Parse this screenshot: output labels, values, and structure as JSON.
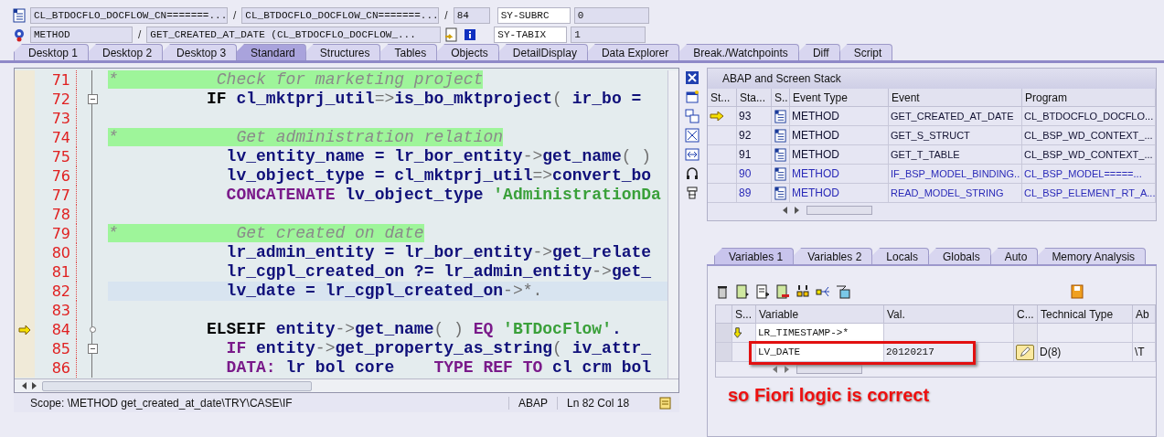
{
  "header": {
    "rows": [
      {
        "fields": [
          {
            "value": "CL_BTDOCFLO_DOCFLOW_CN=======..."
          },
          {
            "sep": "/",
            "value": "CL_BTDOCFLO_DOCFLOW_CN=======..."
          },
          {
            "sep": "/",
            "value": "84"
          }
        ],
        "sys_name": "SY-SUBRC",
        "sys_value": "0"
      },
      {
        "fields": [
          {
            "value": "METHOD"
          },
          {
            "sep": "/",
            "value": "GET_CREATED_AT_DATE (CL_BTDOCFLO_DOCFLOW_..."
          }
        ],
        "sys_name": "SY-TABIX",
        "sys_value": "1"
      }
    ]
  },
  "tabs": [
    {
      "label": "Desktop 1",
      "selected": false
    },
    {
      "label": "Desktop 2",
      "selected": false
    },
    {
      "label": "Desktop 3",
      "selected": false
    },
    {
      "label": "Standard",
      "selected": true
    },
    {
      "label": "Structures",
      "selected": false
    },
    {
      "label": "Tables",
      "selected": false
    },
    {
      "label": "Objects",
      "selected": false
    },
    {
      "label": "DetailDisplay",
      "selected": false
    },
    {
      "label": "Data Explorer",
      "selected": false
    },
    {
      "label": "Break./Watchpoints",
      "selected": false
    },
    {
      "label": "Diff",
      "selected": false
    },
    {
      "label": "Script",
      "selected": false
    }
  ],
  "editor": {
    "lines": [
      {
        "number": "71",
        "comment": true,
        "current": false,
        "cursor": false,
        "collapsible": false,
        "tokens": [
          {
            "text": "*          Check for marketing project",
            "kind": "comment"
          }
        ]
      },
      {
        "number": "72",
        "comment": false,
        "current": false,
        "cursor": false,
        "collapsible": true,
        "tokens": [
          {
            "text": "          IF",
            "kind": "keyword"
          },
          {
            "text": " cl_mktprj_util",
            "kind": "ident"
          },
          {
            "text": "=>",
            "kind": "op"
          },
          {
            "text": "is_bo_mktproject",
            "kind": "ident"
          },
          {
            "text": "( ",
            "kind": "op"
          },
          {
            "text": "ir_bo =",
            "kind": "ident"
          }
        ]
      },
      {
        "number": "73",
        "current": false,
        "cursor": false,
        "collapsible": false
      },
      {
        "number": "74",
        "comment": true,
        "current": false,
        "cursor": false,
        "collapsible": false,
        "tokens": [
          {
            "text": "*            Get administration relation",
            "kind": "comment"
          }
        ]
      },
      {
        "number": "75",
        "comment": false,
        "current": false,
        "cursor": false,
        "collapsible": false,
        "tokens": [
          {
            "text": "            lv_entity_name = lr_bor_entity",
            "kind": "ident"
          },
          {
            "text": "->",
            "kind": "op"
          },
          {
            "text": "get_name",
            "kind": "ident"
          },
          {
            "text": "( )",
            "kind": "op"
          }
        ]
      },
      {
        "number": "76",
        "comment": false,
        "current": false,
        "cursor": false,
        "collapsible": false,
        "tokens": [
          {
            "text": "            lv_object_type = cl_mktprj_util",
            "kind": "ident"
          },
          {
            "text": "=>",
            "kind": "op"
          },
          {
            "text": "convert_bo",
            "kind": "ident"
          }
        ]
      },
      {
        "number": "77",
        "comment": false,
        "current": false,
        "cursor": false,
        "collapsible": false,
        "tokens": [
          {
            "text": "            CONCATENATE",
            "kind": "keyword2"
          },
          {
            "text": " lv_object_type ",
            "kind": "ident"
          },
          {
            "text": "'AdministrationDa",
            "kind": "string"
          }
        ]
      },
      {
        "number": "78",
        "current": false,
        "cursor": false,
        "collapsible": false
      },
      {
        "number": "79",
        "comment": true,
        "current": false,
        "cursor": false,
        "collapsible": false,
        "tokens": [
          {
            "text": "*            Get created on date",
            "kind": "comment"
          }
        ]
      },
      {
        "number": "80",
        "comment": false,
        "current": false,
        "cursor": false,
        "collapsible": false,
        "tokens": [
          {
            "text": "            lr_admin_entity = lr_bor_entity",
            "kind": "ident"
          },
          {
            "text": "->",
            "kind": "op"
          },
          {
            "text": "get_relate",
            "kind": "ident"
          }
        ]
      },
      {
        "number": "81",
        "comment": false,
        "current": false,
        "cursor": false,
        "collapsible": false,
        "tokens": [
          {
            "text": "            lr_cgpl_created_on ?= lr_admin_entity",
            "kind": "ident"
          },
          {
            "text": "->",
            "kind": "op"
          },
          {
            "text": "get_",
            "kind": "ident"
          }
        ]
      },
      {
        "number": "82",
        "comment": false,
        "current": false,
        "cursor": true,
        "collapsible": false,
        "tokens": [
          {
            "text": "            lv_date = lr_cgpl_created_on",
            "kind": "ident"
          },
          {
            "text": "->*.",
            "kind": "op"
          }
        ]
      },
      {
        "number": "83",
        "current": false,
        "cursor": false,
        "collapsible": false
      },
      {
        "number": "84",
        "comment": false,
        "current": true,
        "cursor": false,
        "collapsible": false,
        "tokens": [
          {
            "text": "          ELSEIF",
            "kind": "keyword"
          },
          {
            "text": " entity",
            "kind": "ident"
          },
          {
            "text": "->",
            "kind": "op"
          },
          {
            "text": "get_name",
            "kind": "ident"
          },
          {
            "text": "( ) ",
            "kind": "op"
          },
          {
            "text": "EQ",
            "kind": "keyword2"
          },
          {
            "text": " 'BTDocFlow'",
            "kind": "string"
          },
          {
            "text": ".",
            "kind": "ident"
          }
        ]
      },
      {
        "number": "85",
        "comment": false,
        "current": false,
        "cursor": false,
        "collapsible": true,
        "tokens": [
          {
            "text": "            IF",
            "kind": "keyword2"
          },
          {
            "text": " entity",
            "kind": "ident"
          },
          {
            "text": "->",
            "kind": "op"
          },
          {
            "text": "get_property_as_string",
            "kind": "ident"
          },
          {
            "text": "( ",
            "kind": "op"
          },
          {
            "text": "iv_attr_",
            "kind": "ident"
          }
        ]
      },
      {
        "number": "86",
        "comment": false,
        "current": false,
        "cursor": false,
        "collapsible": false,
        "tokens": [
          {
            "text": "            DATA:",
            "kind": "keyword2"
          },
          {
            "text": " lr bol core    ",
            "kind": "ident"
          },
          {
            "text": "TYPE REF TO",
            "kind": "keyword2"
          },
          {
            "text": " cl crm bol",
            "kind": "ident"
          }
        ]
      }
    ],
    "status": {
      "scope": "Scope: \\METHOD get_created_at_date\\TRY\\CASE\\IF",
      "language": "ABAP",
      "position": "Ln  82 Col  18"
    }
  },
  "stack": {
    "title": "ABAP and Screen Stack",
    "columns": [
      "St...",
      "Sta...",
      "S..",
      "Event Type",
      "Event",
      "Program"
    ],
    "rows": [
      {
        "current": true,
        "level": "93",
        "event_type": "METHOD",
        "event": "GET_CREATED_AT_DATE",
        "program": "CL_BTDOCFLO_DOCFLO...",
        "color": "#101030"
      },
      {
        "current": false,
        "level": "92",
        "event_type": "METHOD",
        "event": "GET_S_STRUCT",
        "program": "CL_BSP_WD_CONTEXT_...",
        "color": "#101030"
      },
      {
        "current": false,
        "level": "91",
        "event_type": "METHOD",
        "event": "GET_T_TABLE",
        "program": "CL_BSP_WD_CONTEXT_...",
        "color": "#101030"
      },
      {
        "current": false,
        "level": "90",
        "event_type": "METHOD",
        "event": "IF_BSP_MODEL_BINDING..",
        "program": "CL_BSP_MODEL=====...",
        "color": "#2a2ab8"
      },
      {
        "current": false,
        "level": "89",
        "event_type": "METHOD",
        "event": "READ_MODEL_STRING",
        "program": "CL_BSP_ELEMENT_RT_A...",
        "color": "#2a2ab8"
      }
    ]
  },
  "variables": {
    "tabs": [
      {
        "label": "Variables 1",
        "selected": true
      },
      {
        "label": "Variables 2",
        "selected": false
      },
      {
        "label": "Locals",
        "selected": false
      },
      {
        "label": "Globals",
        "selected": false
      },
      {
        "label": "Auto",
        "selected": false
      },
      {
        "label": "Memory Analysis",
        "selected": false
      }
    ],
    "columns": [
      "S...",
      "Variable",
      "Val.",
      "C...",
      "Technical Type",
      "Ab"
    ],
    "rows": [
      {
        "kind": "reference",
        "name": "LR_TIMESTAMP->*",
        "editable": false,
        "highlighted": false
      },
      {
        "kind": "plain",
        "name": "LV_DATE",
        "value": "20120217",
        "technical_type": "D(8)",
        "absolute_type": "\\T",
        "editable": true,
        "highlighted": true
      }
    ]
  },
  "annotation": {
    "text": "so Fiori logic is correct"
  }
}
